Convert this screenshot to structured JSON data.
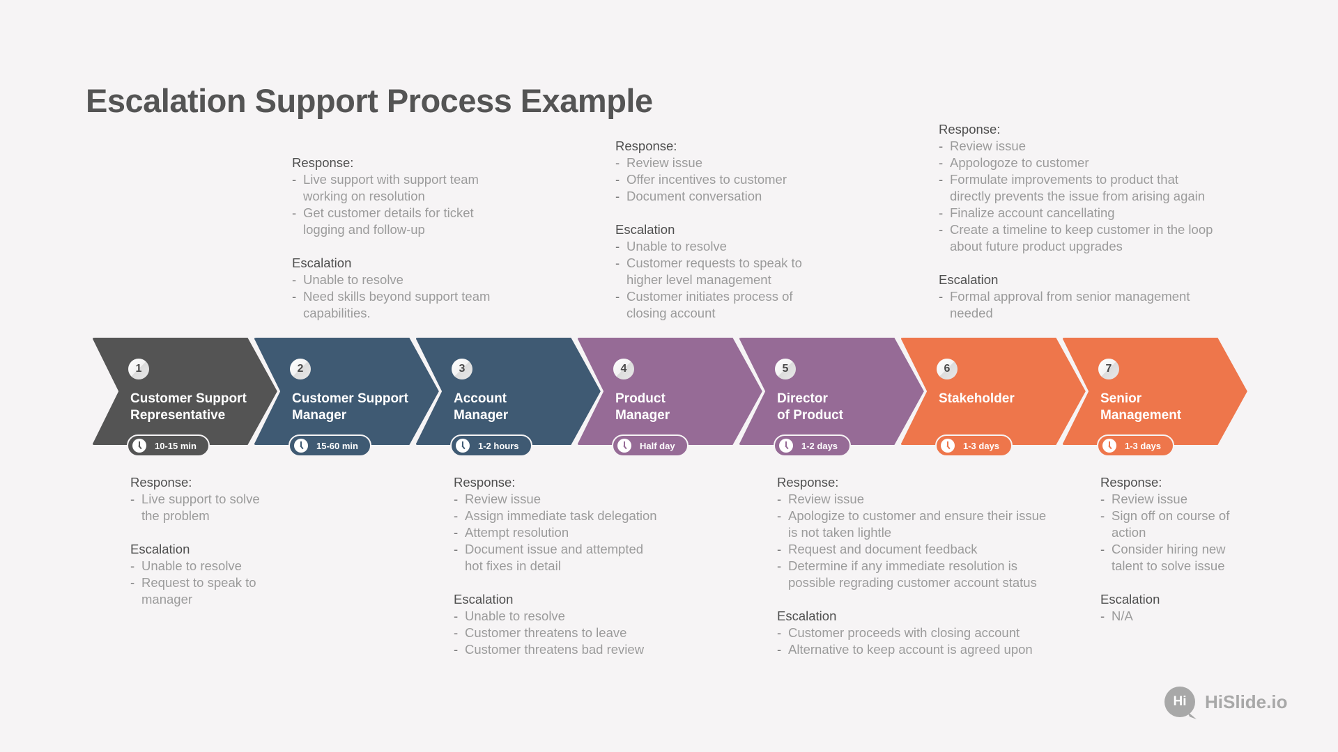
{
  "title": "Escalation Support Process Example",
  "colors": {
    "background": "#f6f4f5",
    "step_dark": "#545454",
    "step_blue": "#3f5a73",
    "step_purple": "#966b96",
    "step_orange": "#ee764b"
  },
  "steps": [
    {
      "number": "1",
      "title_lines": [
        "Customer Support",
        "Representative"
      ],
      "duration": "10-15 min",
      "color": "#545454",
      "notes_position": "bottom",
      "response_label": "Response:",
      "response": [
        "Live support to solve|the problem"
      ],
      "escalation_label": "Escalation",
      "escalation": [
        "Unable to resolve",
        "Request to speak to|manager"
      ]
    },
    {
      "number": "2",
      "title_lines": [
        "Customer Support",
        "Manager"
      ],
      "duration": "15-60 min",
      "color": "#3f5a73",
      "notes_position": "top",
      "response_label": "Response:",
      "response": [
        "Live support with support team|working on resolution",
        "Get customer details for ticket|logging and follow-up"
      ],
      "escalation_label": "Escalation",
      "escalation": [
        "Unable to resolve",
        "Need skills beyond support team|capabilities."
      ]
    },
    {
      "number": "3",
      "title_lines": [
        "Account",
        "Manager"
      ],
      "duration": "1-2 hours",
      "color": "#3f5a73",
      "notes_position": "bottom",
      "response_label": "Response:",
      "response": [
        "Review issue",
        "Assign immediate task delegation",
        "Attempt resolution",
        "Document issue and attempted|hot fixes in detail"
      ],
      "escalation_label": "Escalation",
      "escalation": [
        "Unable to resolve",
        "Customer threatens to leave",
        "Customer threatens bad review"
      ]
    },
    {
      "number": "4",
      "title_lines": [
        "Product",
        "Manager"
      ],
      "duration": "Half day",
      "color": "#966b96",
      "notes_position": "top",
      "response_label": "Response:",
      "response": [
        "Review issue",
        "Offer incentives to customer",
        "Document conversation"
      ],
      "escalation_label": "Escalation",
      "escalation": [
        "Unable to resolve",
        "Customer requests to speak to|higher level management",
        "Customer initiates process of|closing account"
      ]
    },
    {
      "number": "5",
      "title_lines": [
        "Director",
        "of Product"
      ],
      "duration": "1-2 days",
      "color": "#966b96",
      "notes_position": "bottom",
      "response_label": "Response:",
      "response": [
        "Review issue",
        "Apologize to customer and ensure their issue|is not taken lightle",
        "Request and document feedback",
        "Determine if any immediate resolution is|possible regrading customer account status"
      ],
      "escalation_label": "Escalation",
      "escalation": [
        "Customer proceeds with closing account",
        "Alternative to keep account is agreed upon"
      ]
    },
    {
      "number": "6",
      "title_lines": [
        "Stakeholder"
      ],
      "duration": "1-3 days",
      "color": "#ee764b",
      "notes_position": "top",
      "response_label": "Response:",
      "response": [
        "Review issue",
        "Appologoze to customer",
        "Formulate improvements to product that|directly prevents the issue from arising again",
        "Finalize account cancellating",
        "Create a timeline to keep customer in the loop|about future product upgrades"
      ],
      "escalation_label": "Escalation",
      "escalation": [
        "Formal approval from senior management|needed"
      ]
    },
    {
      "number": "7",
      "title_lines": [
        "Senior",
        "Management"
      ],
      "duration": "1-3 days",
      "color": "#ee764b",
      "notes_position": "bottom",
      "response_label": "Response:",
      "response": [
        "Review issue",
        "Sign off on course of|action",
        "Consider hiring new|talent to solve issue"
      ],
      "escalation_label": "Escalation",
      "escalation": [
        "N/A"
      ]
    }
  ],
  "logo": {
    "mark": "Hi",
    "text": "HiSlide.io"
  }
}
